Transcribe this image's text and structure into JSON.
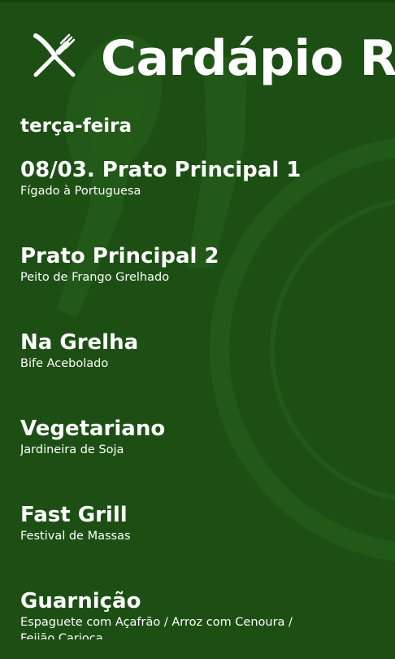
{
  "app": {
    "title": "Cardápio Restaurante",
    "icon": "fork-and-knife-icon"
  },
  "colors": {
    "background": "#1d4f14",
    "text": "#ffffff"
  },
  "day": "terça-feira",
  "menu": [
    {
      "title": "08/03. Prato Principal 1",
      "description": "Fígado à Portuguesa"
    },
    {
      "title": "Prato Principal 2",
      "description": "Peito de Frango Grelhado"
    },
    {
      "title": "Na Grelha",
      "description": "Bife Acebolado"
    },
    {
      "title": "Vegetariano",
      "description": "Jardineira de Soja"
    },
    {
      "title": "Fast Grill",
      "description": "Festival de Massas"
    },
    {
      "title": "Guarnição",
      "description": "Espaguete com Açafrão / Arroz com Cenoura / Feijão Carioca"
    }
  ]
}
